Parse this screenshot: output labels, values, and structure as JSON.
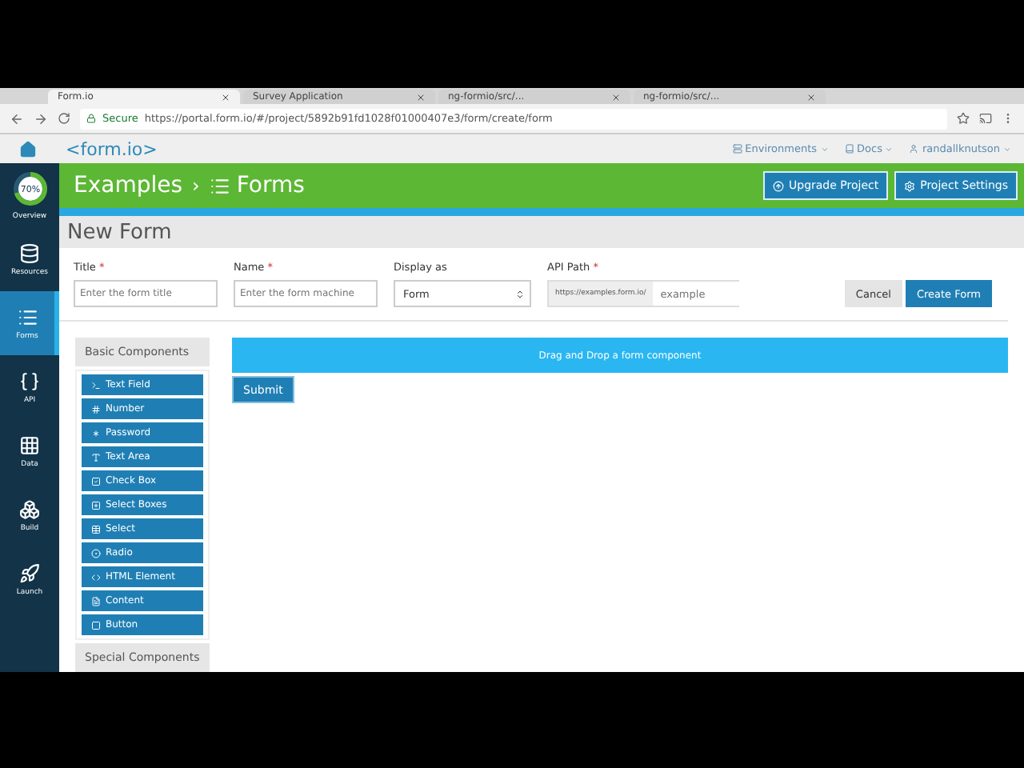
{
  "browser": {
    "tabs": [
      {
        "title": "Form.io",
        "selected": true
      },
      {
        "title": "Survey Application",
        "selected": false
      },
      {
        "title": "ng-formio/src/...",
        "selected": false
      },
      {
        "title": "ng-formio/src/...",
        "selected": false
      }
    ],
    "secure_label": "Secure",
    "url": "https://portal.form.io/#/project/5892b91fd1028f01000407e3/form/create/form"
  },
  "app_nav": {
    "logo": "<form.io>",
    "menu": [
      {
        "label": "Environments",
        "kind": "environments"
      },
      {
        "label": "Docs",
        "kind": "docs"
      },
      {
        "label": "randallknutson",
        "kind": "user"
      }
    ]
  },
  "sidebar": {
    "items": [
      {
        "label": "Overview",
        "kind": "overview",
        "badge": "70%",
        "level": 0.7,
        "selected": false
      },
      {
        "label": "Resources",
        "kind": "resources",
        "selected": false
      },
      {
        "label": "Forms",
        "kind": "forms",
        "selected": true
      },
      {
        "label": "API",
        "kind": "api",
        "selected": false
      },
      {
        "label": "Data",
        "kind": "data",
        "selected": false
      },
      {
        "label": "Build",
        "kind": "build",
        "selected": false
      },
      {
        "label": "Launch",
        "kind": "launch",
        "selected": false
      }
    ]
  },
  "header": {
    "breadcrumb": [
      "Examples",
      "Forms"
    ],
    "separator": "›",
    "buttons": [
      {
        "label": "Upgrade Project",
        "kind": "upgrade"
      },
      {
        "label": "Project Settings",
        "kind": "settings"
      }
    ]
  },
  "page_title": "New Form",
  "required_mark": "*",
  "fields": [
    {
      "label": "Title",
      "required": true,
      "kind": "text",
      "placeholder": "Enter the form title"
    },
    {
      "label": "Name",
      "required": true,
      "kind": "text",
      "placeholder": "Enter the form machine"
    },
    {
      "label": "Display as",
      "required": false,
      "kind": "select",
      "value": "Form"
    },
    {
      "label": "API Path",
      "required": true,
      "kind": "path",
      "prefix": "https://examples.form.io/",
      "placeholder": "example"
    }
  ],
  "actions": [
    {
      "label": "Cancel",
      "kind": "secondary"
    },
    {
      "label": "Create Form",
      "kind": "primary"
    }
  ],
  "components": {
    "groups": [
      {
        "title": "Basic Components",
        "items": [
          {
            "label": "Text Field",
            "kind": "textfield"
          },
          {
            "label": "Number",
            "kind": "number"
          },
          {
            "label": "Password",
            "kind": "password"
          },
          {
            "label": "Text Area",
            "kind": "textarea"
          },
          {
            "label": "Check Box",
            "kind": "checkbox"
          },
          {
            "label": "Select Boxes",
            "kind": "selectboxes"
          },
          {
            "label": "Select",
            "kind": "select"
          },
          {
            "label": "Radio",
            "kind": "radio"
          },
          {
            "label": "HTML Element",
            "kind": "html"
          },
          {
            "label": "Content",
            "kind": "content"
          },
          {
            "label": "Button",
            "kind": "button"
          }
        ]
      },
      {
        "title": "Special Components"
      }
    ]
  },
  "canvas": {
    "dropzone": "Drag and Drop a form component",
    "submit": "Submit"
  }
}
